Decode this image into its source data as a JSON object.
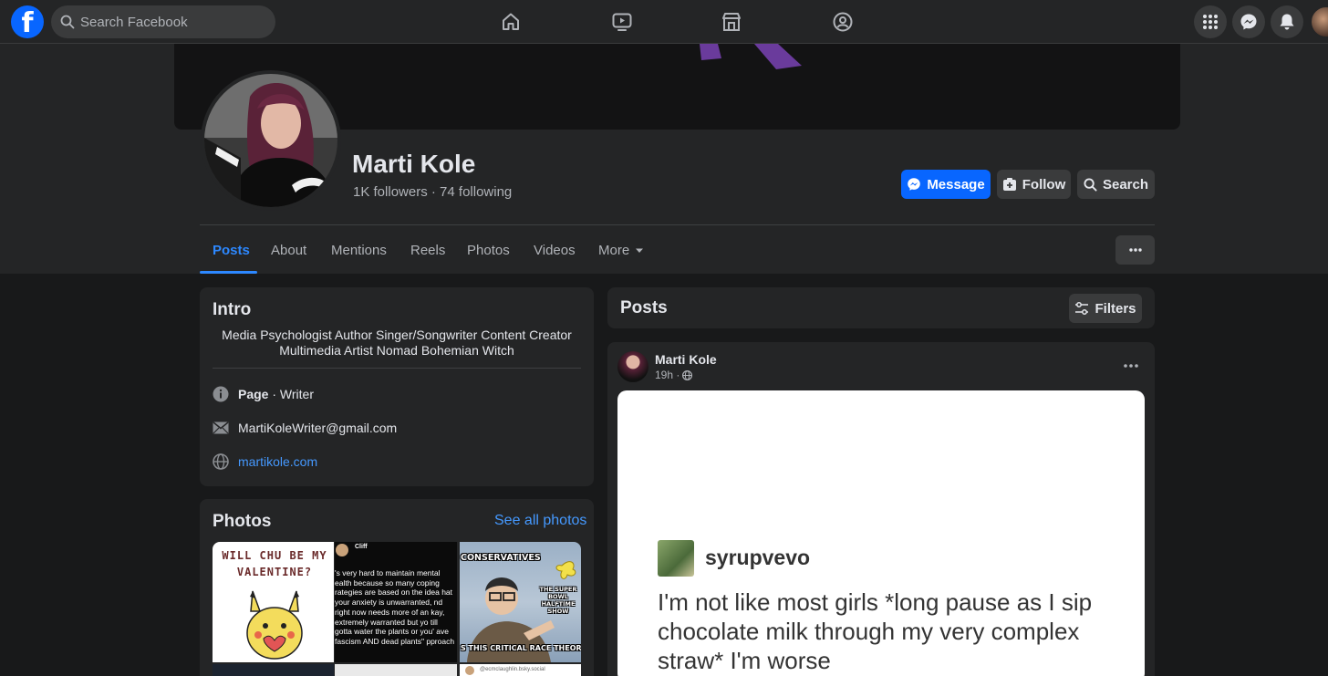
{
  "topbar": {
    "logo_letter": "f",
    "search_placeholder": "Search Facebook",
    "nav_icons": [
      "home-icon",
      "video-icon",
      "marketplace-icon",
      "groups-icon"
    ],
    "right_icons": [
      "menu-grid-icon",
      "messenger-icon",
      "notifications-icon"
    ]
  },
  "profile": {
    "name": "Marti Kole",
    "followers": "1K followers",
    "separator": " · ",
    "following": "74 following",
    "buttons": {
      "message": "Message",
      "follow": "Follow",
      "search": "Search"
    }
  },
  "tabs": {
    "items": [
      "Posts",
      "About",
      "Mentions",
      "Reels",
      "Photos",
      "Videos",
      "More"
    ],
    "active": "Posts"
  },
  "intro": {
    "title": "Intro",
    "bio_line1": "Media Psychologist Author Singer/Songwriter Content Creator",
    "bio_line2": "Multimedia Artist Nomad Bohemian Witch",
    "page_label": "Page",
    "page_category": " · Writer",
    "email": "MartiKoleWriter@gmail.com",
    "website": "martikole.com"
  },
  "photos": {
    "title": "Photos",
    "see_all": "See all photos",
    "photo1_text": "WILL CHU BE MY VALENTINE?",
    "photo2_header": "Cliff",
    "photo2_text": "'s very hard to maintain mental ealth because so many coping rategies are based on the idea hat your anxiety is unwarranted, nd right now needs more of an kay, extremely warranted but yo till gotta water the plants or you' ave fascism AND dead plants\" pproach",
    "photo3_top": "CONSERVATIVES",
    "photo3_mid": "THE SUPER BOWL HALFTIME SHOW",
    "photo3_bottom": "S THIS CRITICAL RACE THEORY?",
    "photo4_text": "@ecmclaughlin.bsky.social"
  },
  "posts_section": {
    "title": "Posts",
    "filters": "Filters"
  },
  "post": {
    "author": "Marti Kole",
    "time": "19h ·",
    "tumblr_user": "syrupvevo",
    "tumblr_text": "I'm not like most girls *long pause as I sip chocolate milk through my very complex straw* I'm worse"
  },
  "colors": {
    "accent": "#0866ff",
    "link": "#4599ff",
    "bg": "#18191a",
    "card": "#242526"
  }
}
